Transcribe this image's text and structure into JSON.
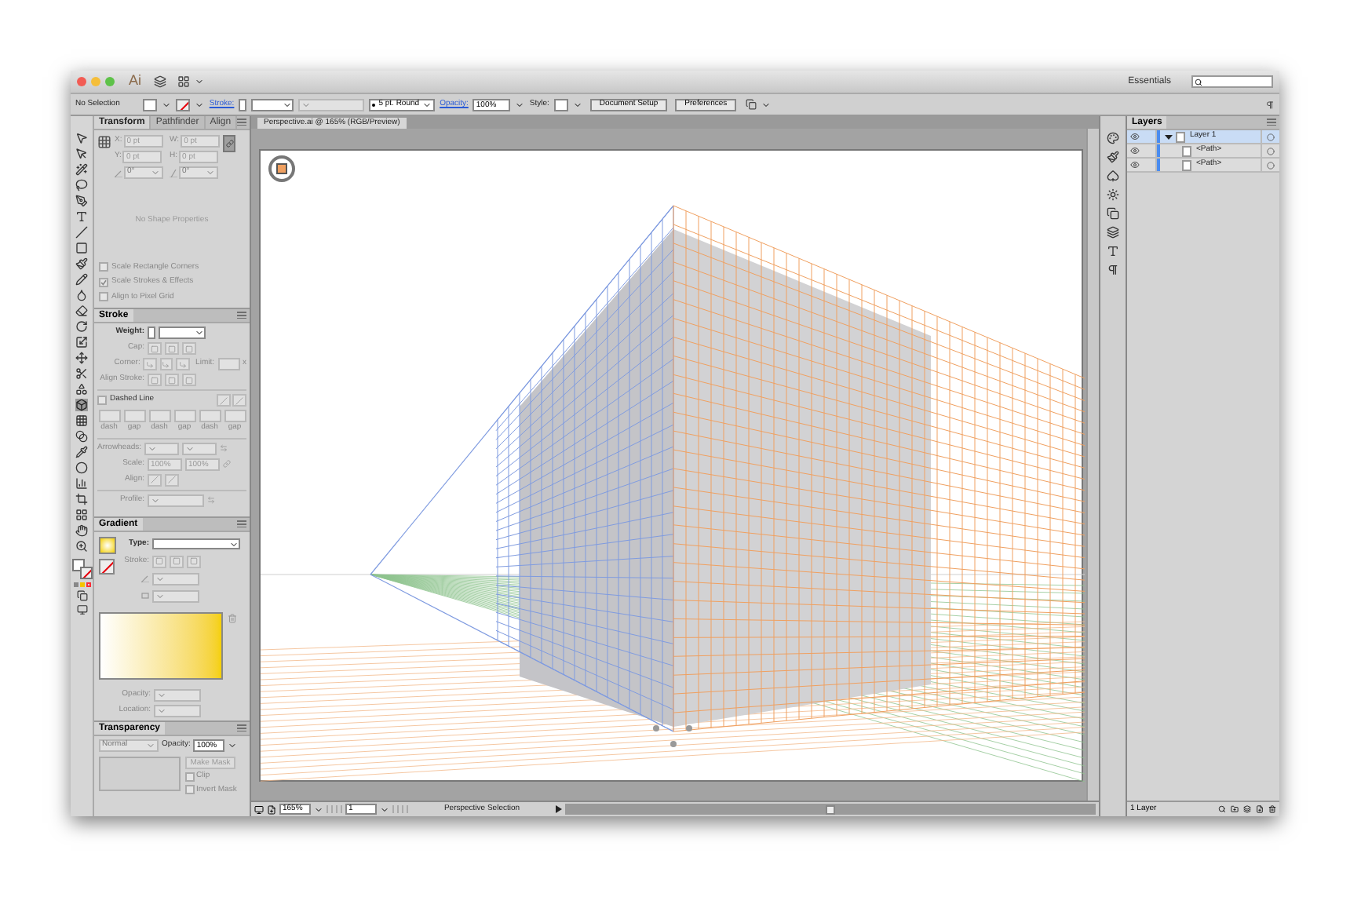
{
  "window": {
    "app_logo": "Ai",
    "workspace": "Essentials"
  },
  "control_bar": {
    "selection": "No Selection",
    "stroke_label": "Stroke:",
    "brush": "5 pt. Round",
    "opacity_label": "Opacity:",
    "opacity": "100%",
    "style_label": "Style:",
    "buttons": [
      "Document Setup",
      "Preferences"
    ]
  },
  "transform_panel": {
    "tabs": [
      {
        "label": "Transform",
        "selected": true
      },
      {
        "label": "Pathfinder",
        "selected": false
      },
      {
        "label": "Align",
        "selected": false
      }
    ],
    "fields": [
      {
        "label": "X:",
        "value": "0 pt"
      },
      {
        "label": "W:",
        "value": "0 pt"
      },
      {
        "label": "Y:",
        "value": "0 pt"
      },
      {
        "label": "H:",
        "value": "0 pt"
      }
    ],
    "rotate": "0°",
    "shear": "0°",
    "message": "No Shape Properties",
    "options": [
      {
        "label": "Scale Rectangle Corners",
        "checked": false
      },
      {
        "label": "Scale Strokes & Effects",
        "checked": true
      },
      {
        "label": "Align to Pixel Grid",
        "checked": false
      }
    ]
  },
  "stroke_panel": {
    "title": "Stroke",
    "weight_label": "Weight:",
    "cap_label": "Cap:",
    "corner_label": "Corner:",
    "limit_label": "Limit:",
    "limit_unit": "x",
    "align_label": "Align Stroke:",
    "dashed": {
      "label": "Dashed Line",
      "checked": false
    },
    "dash_labels": [
      "dash",
      "gap",
      "dash",
      "gap",
      "dash",
      "gap"
    ],
    "arrowheads_label": "Arrowheads:",
    "scale_label": "Scale:",
    "scale_values": [
      "100%",
      "100%"
    ],
    "arrow_align_label": "Align:",
    "profile_label": "Profile:"
  },
  "gradient_panel": {
    "title": "Gradient",
    "type_label": "Type:",
    "stroke_label": "Stroke:",
    "opacity_label": "Opacity:",
    "location_label": "Location:"
  },
  "transparency_panel": {
    "title": "Transparency",
    "blend_mode": "Normal",
    "opacity_label": "Opacity:",
    "opacity": "100%",
    "make_mask": "Make Mask",
    "clip": {
      "label": "Clip",
      "checked": false
    },
    "invert_mask": {
      "label": "Invert Mask",
      "checked": false
    }
  },
  "document": {
    "tab": "Perspective.ai @ 165% (RGB/Preview)"
  },
  "status_bar": {
    "zoom": "165%",
    "artboard": "1",
    "tool": "Perspective Selection"
  },
  "layers_panel": {
    "title": "Layers",
    "rows": [
      {
        "name": "Layer 1",
        "expanded": true,
        "selected": true,
        "children": [
          {
            "name": "<Path>",
            "selected": false
          },
          {
            "name": "<Path>",
            "selected": false
          }
        ]
      }
    ],
    "footer": "1 Layer"
  }
}
